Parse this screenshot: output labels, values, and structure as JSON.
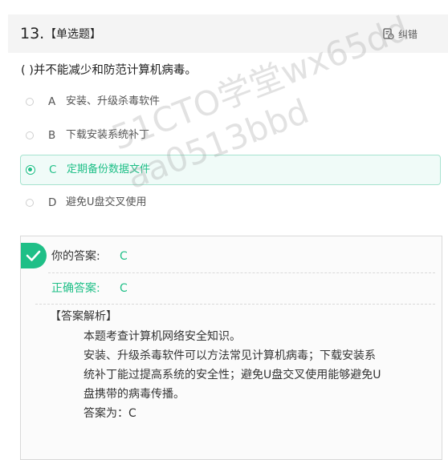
{
  "question": {
    "number": "13.",
    "type_label": "【单选题】",
    "report_label": "纠错",
    "text": "( )并不能减少和防范计算机病毒。"
  },
  "options": [
    {
      "letter": "A",
      "text": "安装、升级杀毒软件",
      "selected": false
    },
    {
      "letter": "B",
      "text": "下载安装系统补丁",
      "selected": false
    },
    {
      "letter": "C",
      "text": "定期备份数据文件",
      "selected": true
    },
    {
      "letter": "D",
      "text": "避免U盘交叉使用",
      "selected": false
    }
  ],
  "answer": {
    "your_label": "你的答案:",
    "your_value": "C",
    "correct_label": "正确答案:",
    "correct_value": "C",
    "analysis_title": "【答案解析】",
    "analysis_lines": [
      "本题考查计算机网络安全知识。",
      "安装、升级杀毒软件可以方法常见计算机病毒；下载安装系",
      "统补丁能过提高系统的安全性；避免U盘交叉使用能够避免U",
      "盘携带的病毒传播。",
      "答案为：C"
    ]
  },
  "watermark": {
    "line1": "51CTO学堂wx65dd",
    "line2": "aa0513bbd"
  },
  "colors": {
    "accent": "#1fbf87",
    "selected_bg": "#f0fbf8",
    "header_bg": "#f4f4f4"
  }
}
